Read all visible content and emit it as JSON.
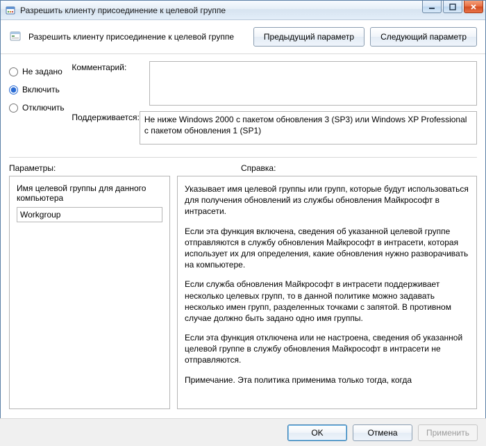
{
  "window": {
    "title": "Разрешить клиенту присоединение к целевой группе"
  },
  "header": {
    "title": "Разрешить клиенту присоединение к целевой группе",
    "prev_button": "Предыдущий параметр",
    "next_button": "Следующий параметр"
  },
  "state_radios": {
    "not_configured": "Не задано",
    "enabled": "Включить",
    "disabled": "Отключить",
    "selected": "enabled"
  },
  "fields": {
    "comment_label": "Комментарий:",
    "comment_value": "",
    "supported_label": "Поддерживается:",
    "supported_value": "Не ниже Windows 2000 с пакетом обновления 3 (SP3) или Windows XP Professional с пакетом обновления 1 (SP1)"
  },
  "sections": {
    "options_label": "Параметры:",
    "help_label": "Справка:"
  },
  "options": {
    "target_group_label": "Имя целевой группы для данного компьютера",
    "target_group_value": "Workgroup"
  },
  "help": {
    "p1": "Указывает имя целевой группы или групп, которые будут использоваться для получения обновлений из службы обновления Майкрософт в интрасети.",
    "p2": "Если эта функция включена, сведения об указанной целевой группе отправляются в службу обновления Майкрософт в интрасети, которая использует их для определения, какие обновления нужно разворачивать на компьютере.",
    "p3": "Если служба обновления Майкрософт в интрасети поддерживает несколько целевых групп, то в данной политике можно задавать несколько имен групп, разделенных точками с запятой. В противном случае должно быть задано одно имя группы.",
    "p4": "Если эта функция отключена или не настроена, сведения об указанной целевой группе в службу обновления Майкрософт в интрасети не отправляются.",
    "p5": "Примечание. Эта политика применима только тогда, когда"
  },
  "buttons": {
    "ok": "OK",
    "cancel": "Отмена",
    "apply": "Применить"
  }
}
